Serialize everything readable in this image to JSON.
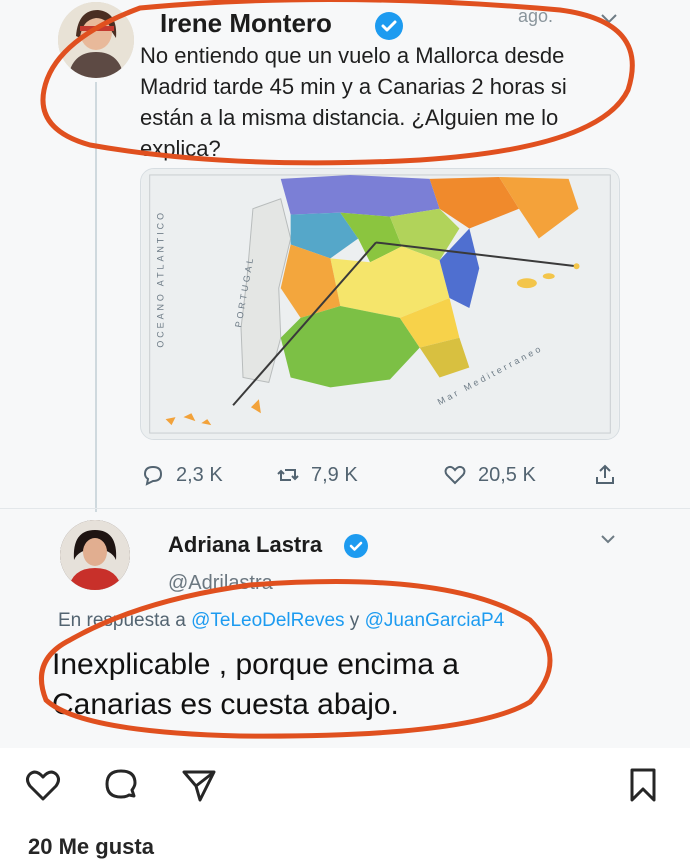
{
  "tweet1": {
    "name": "Irene Montero",
    "time": "ago.",
    "text": "No entiendo que un vuelo a Mallorca desde Madrid tarde 45 min y a Canarias 2 horas si están a la misma distancia. ¿Alguien me lo explica?",
    "map": {
      "ocean_label": "OCEANO ATLANTICO",
      "portugal_label": "PORTUGAL",
      "sea_label": "Mar Mediterraneo",
      "regions": [
        "Cataluña",
        "Aragón",
        "Castilla-La Mancha",
        "Extremadura",
        "Andalucía",
        "Murcia",
        "Baleares",
        "Madrid",
        "Canarias"
      ]
    },
    "stats": {
      "replies": "2,3 K",
      "retweets": "7,9 K",
      "likes": "20,5 K"
    }
  },
  "tweet2": {
    "name": "Adriana Lastra",
    "handle": "@Adrilastra",
    "reply_prefix": "En respuesta a",
    "reply_mention1": "@TeLeoDelReves",
    "reply_and": "y",
    "reply_mention2": "@JuanGarciaP4",
    "text": "Inexplicable , porque encima a Canarias es cuesta abajo."
  },
  "instagram": {
    "likes": "20 Me gusta"
  },
  "colors": {
    "annotation": "#e0501f",
    "link": "#1d9bf0",
    "verified": "#1d9bf0"
  }
}
